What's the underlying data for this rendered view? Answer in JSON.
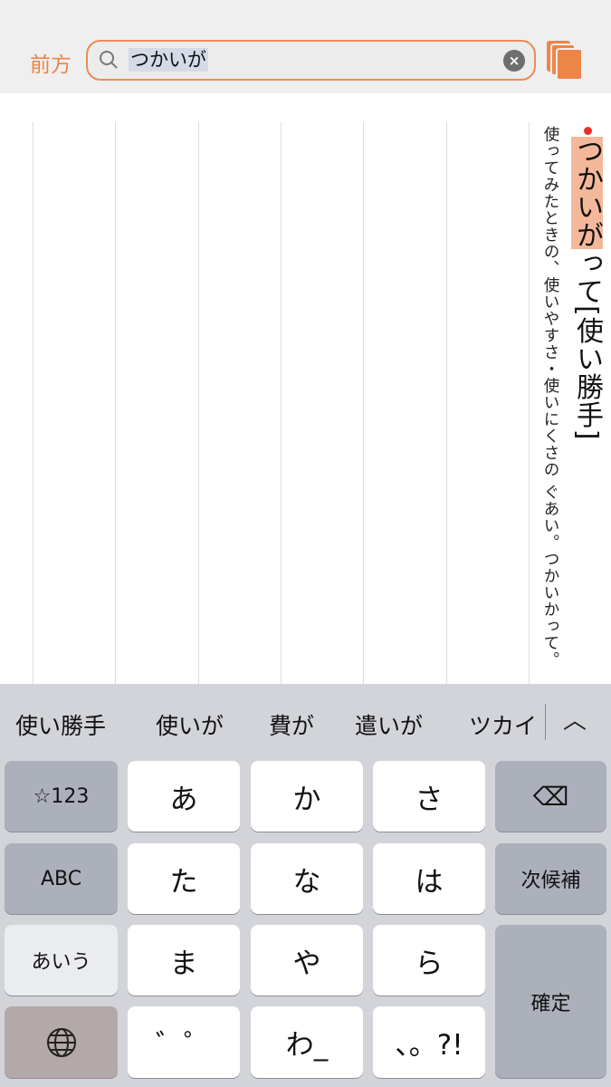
{
  "header": {
    "back_label": "前方",
    "search_value": "つかいが",
    "clear_icon": "clear-icon",
    "books_icon": "books-icon",
    "accent": "#ee8548"
  },
  "entry": {
    "headword_highlight": "つかいが",
    "headword_rest": "って[使い勝手]",
    "definition": "使ってみたときの、使いやすさ・使いにくさの ぐあい。つかいかって。",
    "highlight_color": "#f3b89a"
  },
  "suggestions": [
    "使い勝手",
    "使いが",
    "費が",
    "遣いが",
    "ツカイ"
  ],
  "keyboard": {
    "rows": [
      [
        "☆123",
        "あ",
        "か",
        "さ",
        "⌫"
      ],
      [
        "ABC",
        "た",
        "な",
        "は",
        "次候補"
      ],
      [
        "あいう",
        "ま",
        "や",
        "ら",
        "確定"
      ],
      [
        "🌐",
        "゛゜",
        "わ_",
        "、。?!"
      ]
    ]
  }
}
